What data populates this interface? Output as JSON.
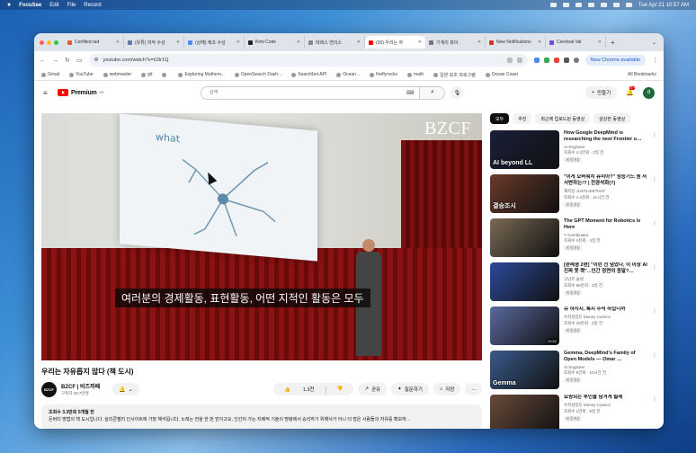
{
  "menubar": {
    "app": "FocuSee",
    "items": [
      "Edit",
      "File",
      "Record"
    ],
    "clock": "Tue Apr 21  10:57 AM"
  },
  "tabs": [
    {
      "title": "Certified rad",
      "color": "#e35d2f"
    },
    {
      "title": "(유튜) 저작 수성",
      "color": "#5f7da8"
    },
    {
      "title": "(상해) 제조 수성",
      "color": "#4b8bf5"
    },
    {
      "title": "Kimi Code",
      "color": "#222222"
    },
    {
      "title": "테레스 연의스",
      "color": "#888888"
    },
    {
      "title": "(30) 우리는 자",
      "color": "#ff0000",
      "active": true
    },
    {
      "title": "기계의 파이",
      "color": "#777777"
    },
    {
      "title": "New Notifications",
      "color": "#d93025"
    },
    {
      "title": "Cerebral Val",
      "color": "#6f4bd8"
    }
  ],
  "address": {
    "url": "youtube.com/watch?v=O3r1Q",
    "new_chrome": "New Chrome available"
  },
  "bookmarks": [
    "Gmail",
    "YouTube",
    "webmaster",
    "git",
    "",
    "Exploring Mathem...",
    "OpenSearch Dash...",
    "Searchbot API",
    "Ocean...",
    "fireflyrocks",
    "math",
    "일본 보조 프로그램",
    "Ocean Coast"
  ],
  "all_bookmarks": "All Bookmarks",
  "youtube": {
    "brand": "Premium",
    "region": "KR",
    "search_placeholder": "검색",
    "create": "만들기",
    "notif_count": "9+",
    "avatar_letter": "d"
  },
  "video": {
    "watermark": "BZCF",
    "slide_word": "what",
    "caption": "여러분의 경제활동, 표현활동, 어떤 지적인 활동은 모두",
    "title": "우리는 자유롭지 않다 (책 도시)",
    "channel": "BZCF | 비즈까페",
    "subscribers": "구독자 29.7만명",
    "likes": "1.3천",
    "share": "공유",
    "ask": "질문하기",
    "save": "저장",
    "more": "...",
    "desc_meta": "조회수 3.3만회  5개월 전",
    "desc_text": "돈버티 방법의 책 도시입니다. 실리콘밸리 인사이트에 가장 해석됩니다. 노래는 전을 한 번 얻이고요, 인간의 가는 지배적 기술이 명령에서 승리하기 위해서가 아니 더 많은 사람들의 자유를 확보하…"
  },
  "chips": [
    "모두",
    "추천",
    "최근에 업로드된 동영상",
    "감상한 동영상"
  ],
  "sidebar": [
    {
      "title": "How Google DeepMind is researching the next Frontier o…",
      "channel": "AI Engineer",
      "views": "조회수 4.2만회 · 2일 전",
      "badge": "새 동영상",
      "duration": "",
      "thumb_text": "AI beyond LL",
      "thumb_color": "#1a1f3a"
    },
    {
      "title": "\"이게 오버워치 유미아?\" 정승기드 뭔 저서변하는!? | 전광석화(?)",
      "channel": "재치있 JUSTLIKETHAT",
      "views": "조회수 4.4천회 · 11시간 전",
      "badge": "새 동영상",
      "duration": "",
      "thumb_text": "결승조시",
      "thumb_color": "#6a3a2a"
    },
    {
      "title": "The GPT Moment for Robotics Is Here",
      "channel": "Y Combinator",
      "views": "조회수 4천회 · 4일 전",
      "badge": "새 동영상",
      "duration": "",
      "thumb_text": "",
      "thumb_color": "#7a6a55"
    },
    {
      "title": "[판례형 2편] \"이런 선 넘었다, 이 이상 AI 진짜 못 쫙\"...인간 정면의 종말?…",
      "channel": "고넌트 슬렛",
      "views": "조회수 95만회 · 3일 전",
      "badge": "새 동영상",
      "duration": "",
      "thumb_text": "",
      "thumb_color": "#2b4a9a"
    },
    {
      "title": "슈 하지시, 록시 주식 하십니까",
      "channel": "수지성장도 Money Comics",
      "views": "조회수 30만회 · 3일 전",
      "badge": "새 동영상",
      "duration": "20:52",
      "thumb_text": "",
      "thumb_color": "#5a6aa0"
    },
    {
      "title": "Gemma, DeepMind's Family of Open Models — Omar …",
      "channel": "AI Engineer",
      "views": "조회수 5만회 · 10시간 전",
      "badge": "새 동영상",
      "duration": "",
      "thumb_text": "Gemma",
      "thumb_color": "#3a5a8a"
    },
    {
      "title": "요핑되는 부인들 남겨게 될레",
      "channel": "수지성장도 Money Comics",
      "views": "조회수 1만회 · 5일 전",
      "badge": "새 동영상",
      "duration": "",
      "thumb_text": "",
      "thumb_color": "#6a4a3a"
    }
  ]
}
